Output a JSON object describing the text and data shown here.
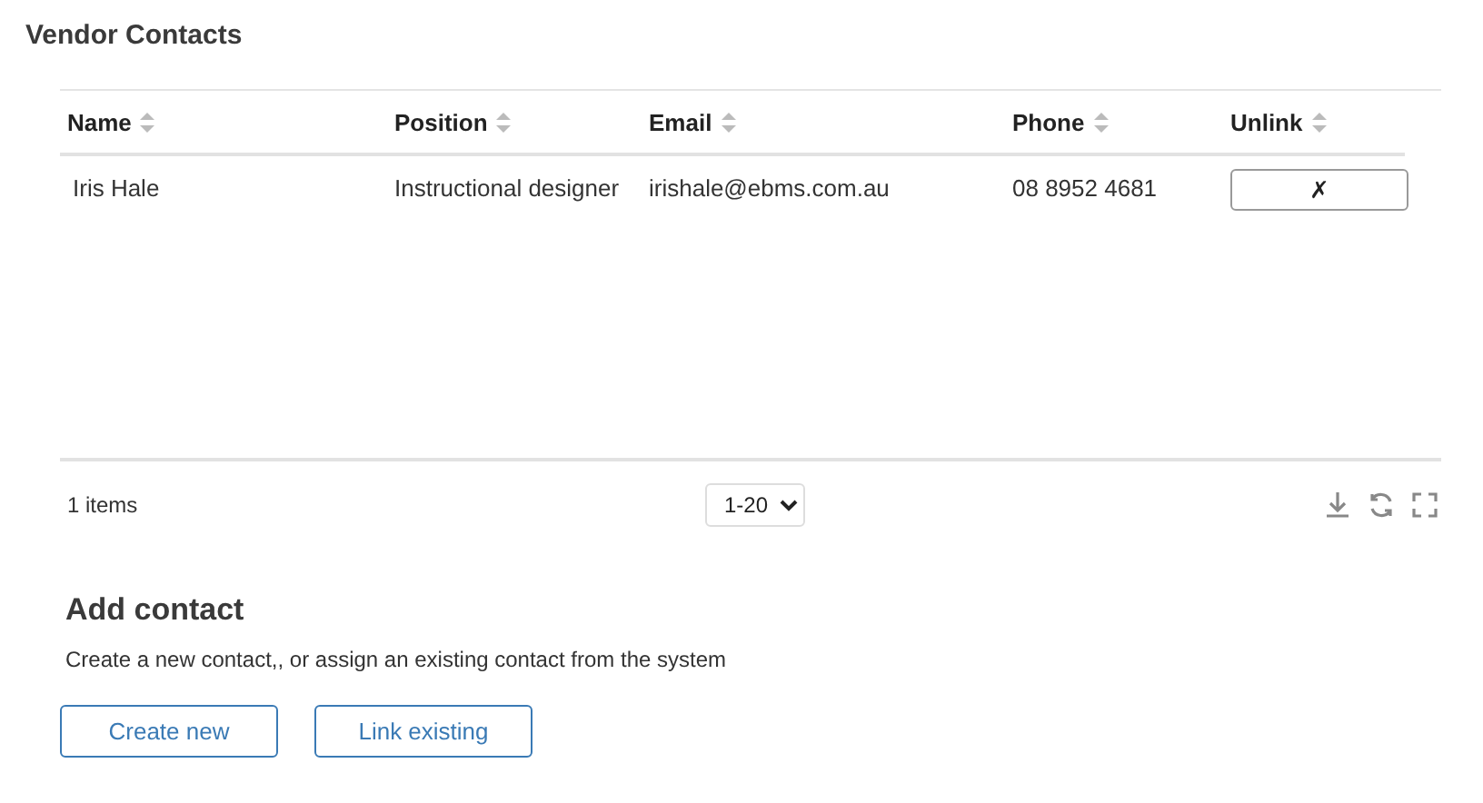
{
  "page_title": "Vendor Contacts",
  "table": {
    "columns": [
      "Name",
      "Position",
      "Email",
      "Phone",
      "Unlink"
    ],
    "rows": [
      {
        "name": "Iris Hale",
        "position": "Instructional designer",
        "email": "irishale@ebms.com.au",
        "phone": "08 8952 4681",
        "unlink": "✗"
      }
    ]
  },
  "footer": {
    "count": "1 items",
    "page_size": "1-20"
  },
  "add_contact": {
    "title": "Add contact",
    "description": "Create a new contact,, or assign an existing contact from the system",
    "buttons": [
      "Create new",
      "Link existing"
    ]
  }
}
